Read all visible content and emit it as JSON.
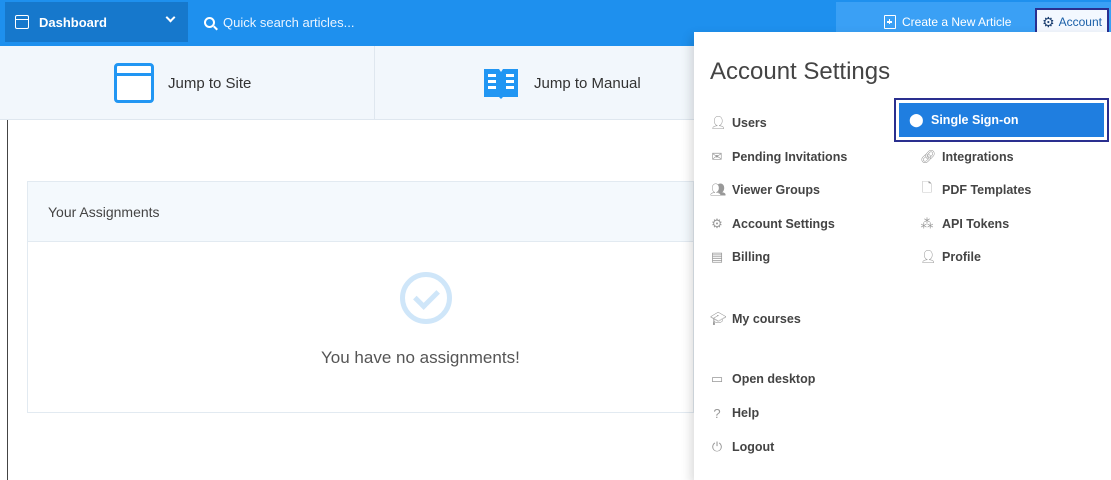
{
  "topbar": {
    "dashboard_label": "Dashboard",
    "search_placeholder": "Quick search articles...",
    "create_label": "Create a New Article",
    "account_label": "Account"
  },
  "jumpbar": {
    "site_label": "Jump to Site",
    "manual_label": "Jump to Manual"
  },
  "assignments": {
    "title": "Your Assignments",
    "empty_text": "You have no assignments!"
  },
  "account_menu": {
    "title": "Account Settings",
    "left_items": [
      {
        "label": "Users",
        "icon": "user-icon"
      },
      {
        "label": "Pending Invitations",
        "icon": "envelope-icon"
      },
      {
        "label": "Viewer Groups",
        "icon": "group-icon"
      },
      {
        "label": "Account Settings",
        "icon": "gear-icon"
      },
      {
        "label": "Billing",
        "icon": "document-icon"
      }
    ],
    "right_items": [
      {
        "label": "Single Sign-on",
        "icon": "shield-icon",
        "active": true
      },
      {
        "label": "Integrations",
        "icon": "link-icon"
      },
      {
        "label": "PDF Templates",
        "icon": "file-icon"
      },
      {
        "label": "API Tokens",
        "icon": "nodes-icon"
      },
      {
        "label": "Profile",
        "icon": "user-icon"
      }
    ],
    "bottom_items": [
      {
        "label": "My courses",
        "icon": "graduation-cap-icon"
      },
      {
        "label": "Open desktop",
        "icon": "laptop-icon"
      },
      {
        "label": "Help",
        "icon": "question-icon"
      },
      {
        "label": "Logout",
        "icon": "power-icon"
      }
    ]
  },
  "colors": {
    "topbar": "#1e90ee",
    "dashboard_bg": "#1678cc",
    "active_item": "#1f7ee0",
    "highlight_border": "#2a2f8f"
  }
}
